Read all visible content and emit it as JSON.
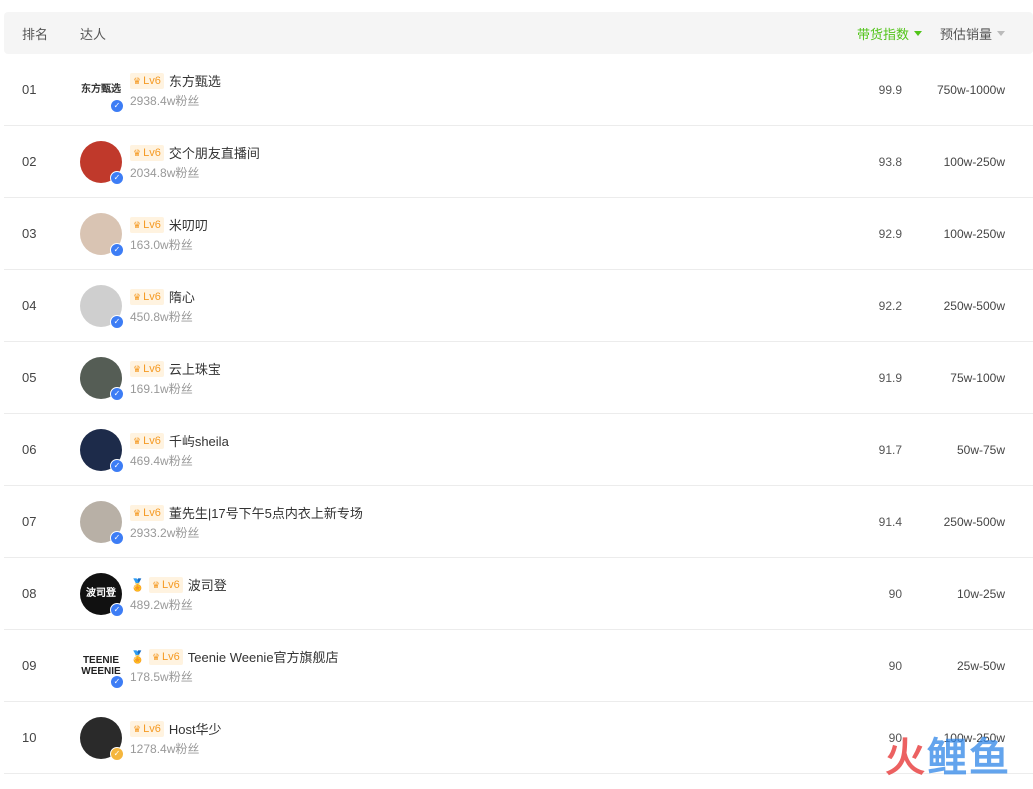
{
  "header": {
    "rank": "排名",
    "talent": "达人",
    "index": "带货指数",
    "sales": "预估销量"
  },
  "rows": [
    {
      "rank": "01",
      "level": "Lv6",
      "name": "东方甄选",
      "fans": "2938.4w粉丝",
      "index": "99.9",
      "sales": "750w-1000w",
      "medal": false,
      "avatar_text": "东方甄选",
      "avatar_bg": "#ffffff",
      "avatar_fg": "#333333",
      "verify": "blue"
    },
    {
      "rank": "02",
      "level": "Lv6",
      "name": "交个朋友直播间",
      "fans": "2034.8w粉丝",
      "index": "93.8",
      "sales": "100w-250w",
      "medal": false,
      "avatar_text": "",
      "avatar_bg": "#c0392b",
      "avatar_fg": "#fff",
      "verify": "blue"
    },
    {
      "rank": "03",
      "level": "Lv6",
      "name": "米叨叨",
      "fans": "163.0w粉丝",
      "index": "92.9",
      "sales": "100w-250w",
      "medal": false,
      "avatar_text": "",
      "avatar_bg": "#d9c4b3",
      "avatar_fg": "#fff",
      "verify": "blue"
    },
    {
      "rank": "04",
      "level": "Lv6",
      "name": "隋心",
      "fans": "450.8w粉丝",
      "index": "92.2",
      "sales": "250w-500w",
      "medal": false,
      "avatar_text": "",
      "avatar_bg": "#cfcfcf",
      "avatar_fg": "#fff",
      "verify": "blue"
    },
    {
      "rank": "05",
      "level": "Lv6",
      "name": "云上珠宝",
      "fans": "169.1w粉丝",
      "index": "91.9",
      "sales": "75w-100w",
      "medal": false,
      "avatar_text": "",
      "avatar_bg": "#555d55",
      "avatar_fg": "#fff",
      "verify": "blue"
    },
    {
      "rank": "06",
      "level": "Lv6",
      "name": "千屿sheila",
      "fans": "469.4w粉丝",
      "index": "91.7",
      "sales": "50w-75w",
      "medal": false,
      "avatar_text": "",
      "avatar_bg": "#1d2b4a",
      "avatar_fg": "#fff",
      "verify": "blue"
    },
    {
      "rank": "07",
      "level": "Lv6",
      "name": "董先生|17号下午5点内衣上新专场",
      "fans": "2933.2w粉丝",
      "index": "91.4",
      "sales": "250w-500w",
      "medal": false,
      "avatar_text": "",
      "avatar_bg": "#b8b0a6",
      "avatar_fg": "#fff",
      "verify": "blue"
    },
    {
      "rank": "08",
      "level": "Lv6",
      "name": "波司登",
      "fans": "489.2w粉丝",
      "index": "90",
      "sales": "10w-25w",
      "medal": true,
      "avatar_text": "波司登",
      "avatar_bg": "#111111",
      "avatar_fg": "#ffffff",
      "verify": "blue"
    },
    {
      "rank": "09",
      "level": "Lv6",
      "name": "Teenie Weenie官方旗舰店",
      "fans": "178.5w粉丝",
      "index": "90",
      "sales": "25w-50w",
      "medal": true,
      "avatar_text": "TEENIE WEENIE",
      "avatar_bg": "#ffffff",
      "avatar_fg": "#222222",
      "verify": "blue"
    },
    {
      "rank": "10",
      "level": "Lv6",
      "name": "Host华少",
      "fans": "1278.4w粉丝",
      "index": "90",
      "sales": "100w-250w",
      "medal": false,
      "avatar_text": "",
      "avatar_bg": "#2a2a2a",
      "avatar_fg": "#fff",
      "verify": "gold"
    }
  ],
  "watermark": {
    "part1": "火",
    "part2": "鲤鱼"
  }
}
